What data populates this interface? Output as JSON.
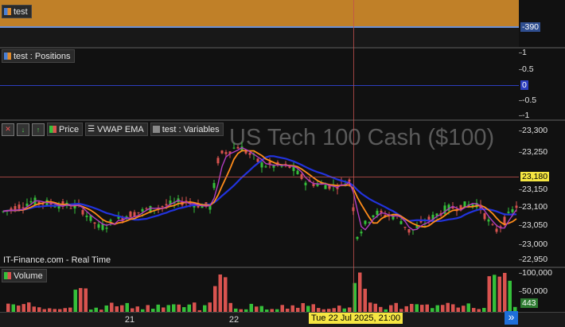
{
  "pane1": {
    "label": "test",
    "value_tag": "-390",
    "fill_color": "#c08028",
    "line_color": "#6b8fd6"
  },
  "pane2": {
    "label": "test : Positions",
    "ticks": [
      "1",
      "0.5",
      "0",
      "-0.5",
      "-1"
    ],
    "value_tag": "0"
  },
  "price_pane": {
    "toolbar_icons": [
      "close-icon",
      "move-down-icon",
      "move-up-icon"
    ],
    "legend": [
      {
        "label": "Price",
        "icon": "candles-icon"
      },
      {
        "label": "VWAP EMA",
        "icon": "list-icon"
      },
      {
        "label": "test : Variables",
        "icon": "box-icon"
      }
    ],
    "watermark": "US Tech 100 Cash ($100)",
    "source": "IT-Finance.com - Real Time",
    "ticks": [
      "23,300",
      "23,250",
      "23,200",
      "23,150",
      "23,100",
      "23,050",
      "23,000",
      "22,950"
    ],
    "price_tag": "23,180",
    "price_tag_color": "#f5e642",
    "up_color": "#35c03a",
    "down_color": "#d9534f"
  },
  "volume_pane": {
    "label": "Volume",
    "ticks": [
      "100,000",
      "50,000"
    ],
    "value_tag": "443"
  },
  "x_axis": {
    "labels": [
      "21",
      "22"
    ],
    "crosshair_label": "Tue 22 Jul 2025, 21:00",
    "scroll_button": "»"
  },
  "chart_data": {
    "type": "candlestick",
    "ylim": [
      22940,
      23320
    ],
    "x": [
      "21",
      "22"
    ],
    "ohlc_sample": [
      {
        "o": 23090,
        "h": 23115,
        "l": 23070,
        "c": 23105
      },
      {
        "o": 23240,
        "h": 23280,
        "l": 23200,
        "c": 23220
      },
      {
        "o": 23150,
        "h": 23160,
        "l": 22950,
        "c": 22980
      },
      {
        "o": 23090,
        "h": 23110,
        "l": 23060,
        "c": 23080
      }
    ],
    "series": [
      {
        "name": "VWAP",
        "color": "#2233dd"
      },
      {
        "name": "EMA",
        "color": "#ff8c1a"
      }
    ],
    "last_price": 23180,
    "volume_last": 443,
    "volume_ylim": [
      0,
      110000
    ]
  }
}
